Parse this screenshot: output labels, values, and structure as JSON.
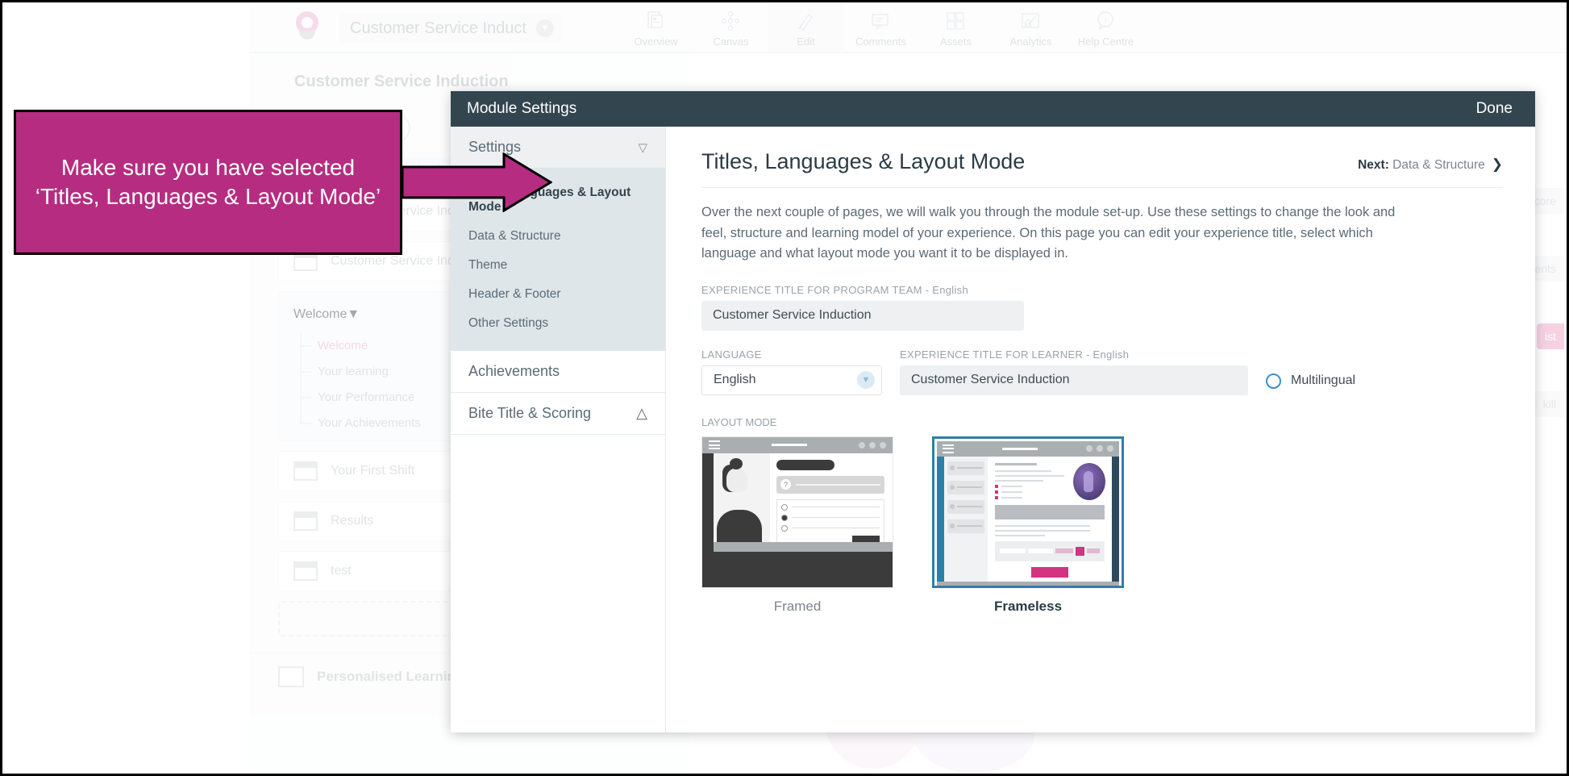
{
  "app": {
    "module_pill": {
      "label": "Customer Service Induct",
      "chevron_icon": "chevron-down-icon"
    },
    "logo_icon": "brand-logo-icon",
    "nav_tabs": [
      {
        "label": "Overview",
        "icon": "overview-icon",
        "active": false
      },
      {
        "label": "Canvas",
        "icon": "canvas-icon",
        "active": false
      },
      {
        "label": "Edit",
        "icon": "pencil-icon",
        "active": true
      },
      {
        "label": "Comments",
        "icon": "comment-icon",
        "active": false
      },
      {
        "label": "Assets",
        "icon": "assets-icon",
        "active": false
      },
      {
        "label": "Analytics",
        "icon": "analytics-icon",
        "active": false
      },
      {
        "label": "Help Centre",
        "icon": "info-icon",
        "active": false
      }
    ]
  },
  "tree": {
    "heading": "Customer Service Induction",
    "subheader": "Customer Service Induction",
    "rows": [
      {
        "label": "Customer Service Indu..."
      },
      {
        "label": "Customer Service Ind..."
      }
    ],
    "group": {
      "label": "Welcome",
      "children": [
        {
          "label": "Welcome",
          "selected": true
        },
        {
          "label": "Your learning",
          "selected": false
        },
        {
          "label": "Your Performance",
          "selected": false
        },
        {
          "label": "Your Achievements",
          "selected": false
        }
      ]
    },
    "rows2": [
      {
        "label": "Your First Shift"
      },
      {
        "label": "Results"
      },
      {
        "label": "test"
      }
    ],
    "add_label": "+",
    "footer_label": "Personalised Learning Plan"
  },
  "background_chips": [
    {
      "label": "Score"
    },
    {
      "label": "ents"
    },
    {
      "label": "ist"
    },
    {
      "label": "kill"
    }
  ],
  "modal": {
    "title": "Module Settings",
    "done_label": "Done",
    "sidebar": {
      "accordion_open": {
        "label": "Settings",
        "chevron_icon": "chevron-down-icon"
      },
      "items": [
        {
          "label": "Titles, Languages & Layout Mode",
          "selected": true
        },
        {
          "label": "Data & Structure",
          "selected": false
        },
        {
          "label": "Theme",
          "selected": false
        },
        {
          "label": "Header & Footer",
          "selected": false
        },
        {
          "label": "Other Settings",
          "selected": false
        }
      ],
      "sections": [
        {
          "label": "Achievements",
          "chevron_icon": ""
        },
        {
          "label": "Bite Title & Scoring",
          "chevron_icon": "chevron-up-icon"
        }
      ]
    },
    "content": {
      "heading": "Titles, Languages & Layout Mode",
      "next_prefix": "Next:",
      "next_label": "Data & Structure",
      "next_chevron_icon": "chevron-right-icon",
      "description": "Over the next couple of pages, we will walk you through the module set-up. Use these settings to change the look and feel, structure and learning model of your experience. On this page you can edit your experience title, select which language and what layout mode you want it to be displayed in.",
      "program_title": {
        "label": "EXPERIENCE TITLE FOR PROGRAM TEAM - English",
        "value": "Customer Service Induction"
      },
      "language": {
        "label": "LANGUAGE",
        "value": "English",
        "chevron_icon": "chevron-down-icon"
      },
      "learner_title": {
        "label": "EXPERIENCE TITLE FOR LEARNER - English",
        "value": "Customer Service Induction"
      },
      "multilingual": {
        "label": "Multilingual",
        "checked": false,
        "accent": "#3a8fcf"
      },
      "layout_mode": {
        "label": "LAYOUT MODE",
        "options": [
          {
            "label": "Framed",
            "selected": false
          },
          {
            "label": "Frameless",
            "selected": true
          }
        ],
        "selected_accent": "#2e7fa8"
      }
    }
  },
  "callout": {
    "text": "Make sure you have selected ‘Titles, Languages & Layout Mode’",
    "fill": "#b62c80",
    "border": "#000000",
    "arrow_icon": "right-arrow-annotation"
  }
}
